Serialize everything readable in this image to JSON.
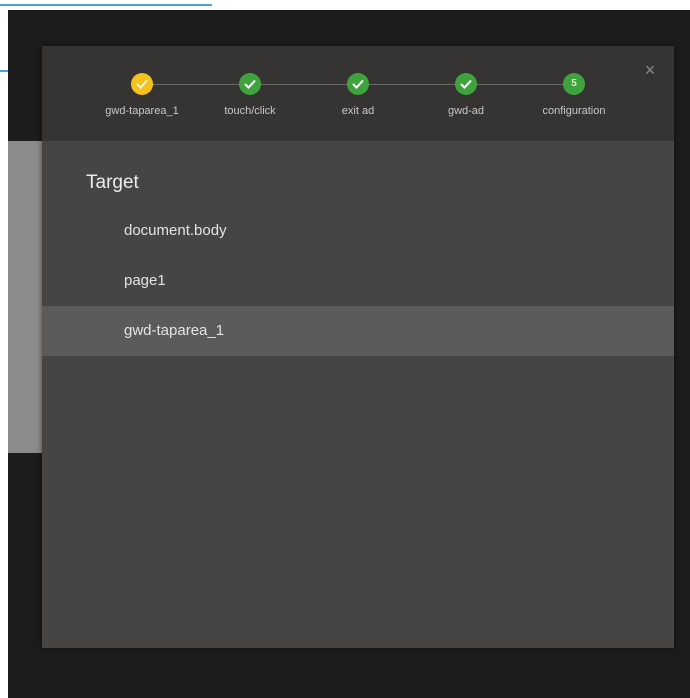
{
  "dialog": {
    "close_glyph": "×",
    "steps": [
      {
        "label": "gwd-taparea_1",
        "state": "current",
        "marker": "check"
      },
      {
        "label": "touch/click",
        "state": "done",
        "marker": "check"
      },
      {
        "label": "exit ad",
        "state": "done",
        "marker": "check"
      },
      {
        "label": "gwd-ad",
        "state": "done",
        "marker": "check"
      },
      {
        "label": "configuration",
        "state": "next",
        "marker": "5"
      }
    ],
    "target": {
      "title": "Target",
      "items": [
        {
          "label": "document.body",
          "selected": false
        },
        {
          "label": "page1",
          "selected": false
        },
        {
          "label": "gwd-taparea_1",
          "selected": true
        }
      ]
    }
  },
  "colors": {
    "current_step": "#f4c21c",
    "done_step": "#3fa33d",
    "dialog_bg": "#464543",
    "header_bg": "#353432",
    "selected_row": "#5c5b59"
  }
}
